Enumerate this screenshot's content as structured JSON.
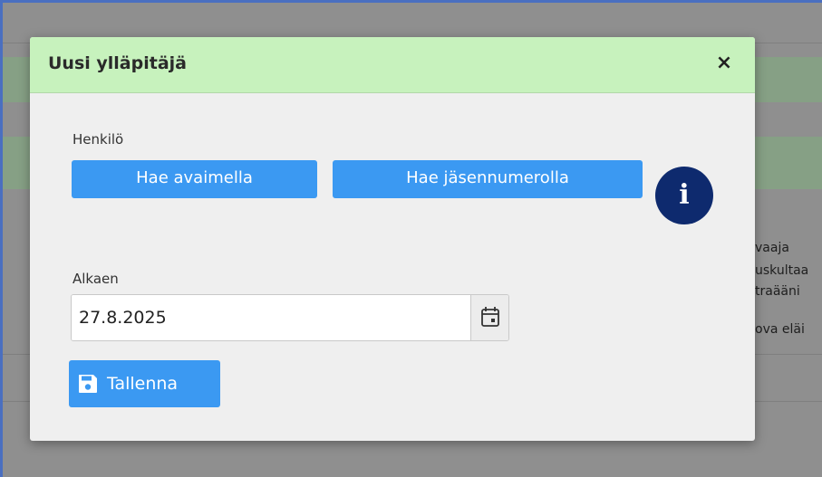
{
  "background": {
    "side_text": [
      "vaaja",
      "uskultaa",
      "traääni",
      "ova eläi"
    ]
  },
  "modal": {
    "title": "Uusi ylläpitäjä",
    "close_label": "×",
    "person_label": "Henkilö",
    "search_by_key_label": "Hae avaimella",
    "search_by_member_number_label": "Hae jäsennumerolla",
    "info_label": "i",
    "start_label": "Alkaen",
    "start_date_value": "27.8.2025",
    "save_label": "Tallenna",
    "icons": {
      "close": "close-icon",
      "info": "info-icon",
      "calendar": "calendar-icon",
      "save": "floppy-disk-icon"
    }
  },
  "colors": {
    "header_bg": "#c7f2bd",
    "primary_button": "#3b99f2",
    "info_button": "#0e2a6e",
    "modal_bg": "#efefef"
  }
}
